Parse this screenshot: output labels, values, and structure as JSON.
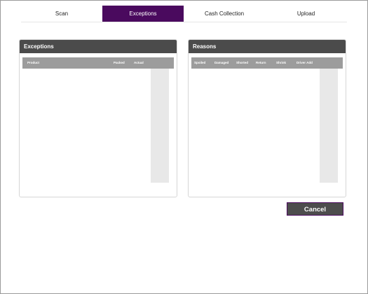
{
  "tabs": [
    {
      "label": "Scan"
    },
    {
      "label": "Exceptions"
    },
    {
      "label": "Cash Collection"
    },
    {
      "label": "Upload"
    }
  ],
  "active_tab": "Exceptions",
  "exceptions_panel": {
    "title": "Exceptions",
    "columns": [
      "Product",
      "Packed",
      "Actual"
    ]
  },
  "reasons_panel": {
    "title": "Reasons",
    "columns": [
      "Spoiled",
      "Damaged",
      "Shorted",
      "Return",
      "Shrink",
      "Driver Add"
    ]
  },
  "actions": {
    "cancel_label": "Cancel"
  },
  "colors": {
    "accent": "#4a0a5e",
    "panel_header": "#4b4b4b",
    "column_header": "#9c9c9c"
  }
}
